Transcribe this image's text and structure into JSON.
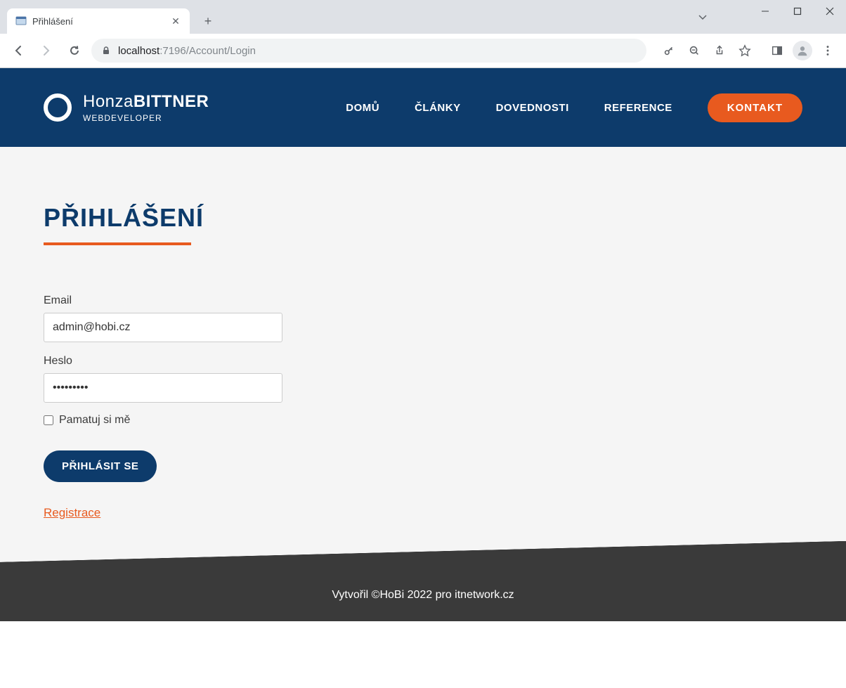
{
  "browser": {
    "tab_title": "Přihlášení",
    "url_host": "localhost",
    "url_port_path": ":7196/Account/Login"
  },
  "header": {
    "logo_name_light": "Honza",
    "logo_name_bold": "BITTNER",
    "logo_sub": "WEBDEVELOPER",
    "nav": [
      "DOMŮ",
      "ČLÁNKY",
      "DOVEDNOSTI",
      "REFERENCE"
    ],
    "cta": "KONTAKT"
  },
  "page": {
    "title": "PŘIHLÁŠENÍ",
    "email_label": "Email",
    "email_value": "admin@hobi.cz",
    "password_label": "Heslo",
    "password_value": "•••••••••",
    "remember_label": "Pamatuj si mě",
    "submit": "PŘIHLÁSIT SE",
    "register_link": "Registrace"
  },
  "footer": {
    "text": "Vytvořil ©HoBi 2022 pro itnetwork.cz"
  }
}
